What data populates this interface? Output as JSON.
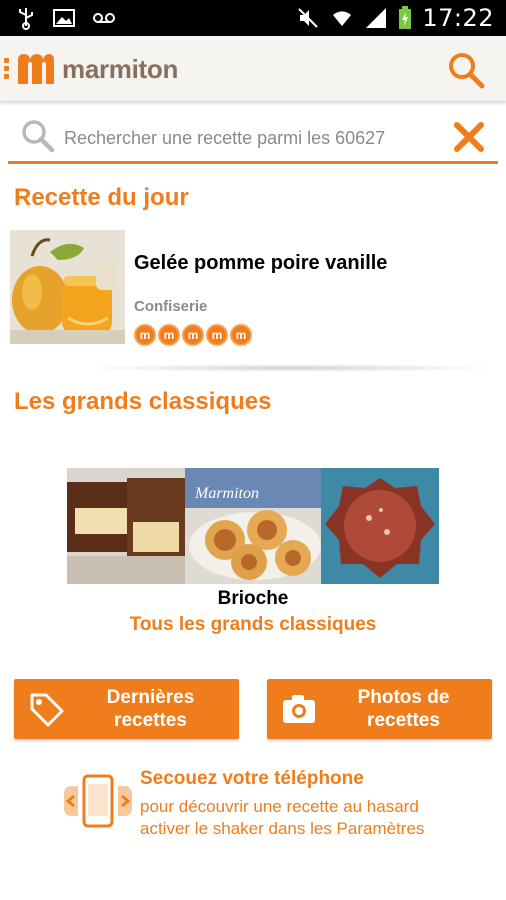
{
  "status_bar": {
    "time": "17:22",
    "icons": [
      "usb-icon",
      "image-icon",
      "voicemail-icon",
      "mute-icon",
      "wifi-icon",
      "signal-icon",
      "battery-charging-icon"
    ]
  },
  "app_bar": {
    "logo_text": "marmiton",
    "search_icon": "search-icon",
    "menu_icon": "menu-dots-icon"
  },
  "search": {
    "placeholder": "Rechercher une recette parmi les 60627",
    "clear_icon": "close-icon"
  },
  "recipe_of_day": {
    "heading": "Recette du jour",
    "title": "Gelée pomme poire vanille",
    "category": "Confiserie",
    "rating_letter": "m",
    "rating": 5,
    "rating_max": 5
  },
  "classics": {
    "heading": "Les grands classiques",
    "current_name": "Brioche",
    "all_link": "Tous les grands classiques"
  },
  "buttons": {
    "latest": "Dernières\nrecettes",
    "photos": "Photos de\nrecettes"
  },
  "shaker": {
    "title": "Secouez votre téléphone",
    "line1": "pour découvrir une recette au hasard",
    "line2": "activer le shaker dans les Paramètres"
  },
  "colors": {
    "accent": "#f07d1c",
    "logo_text": "#8a6f5c",
    "muted_text": "#8a8a8a"
  }
}
